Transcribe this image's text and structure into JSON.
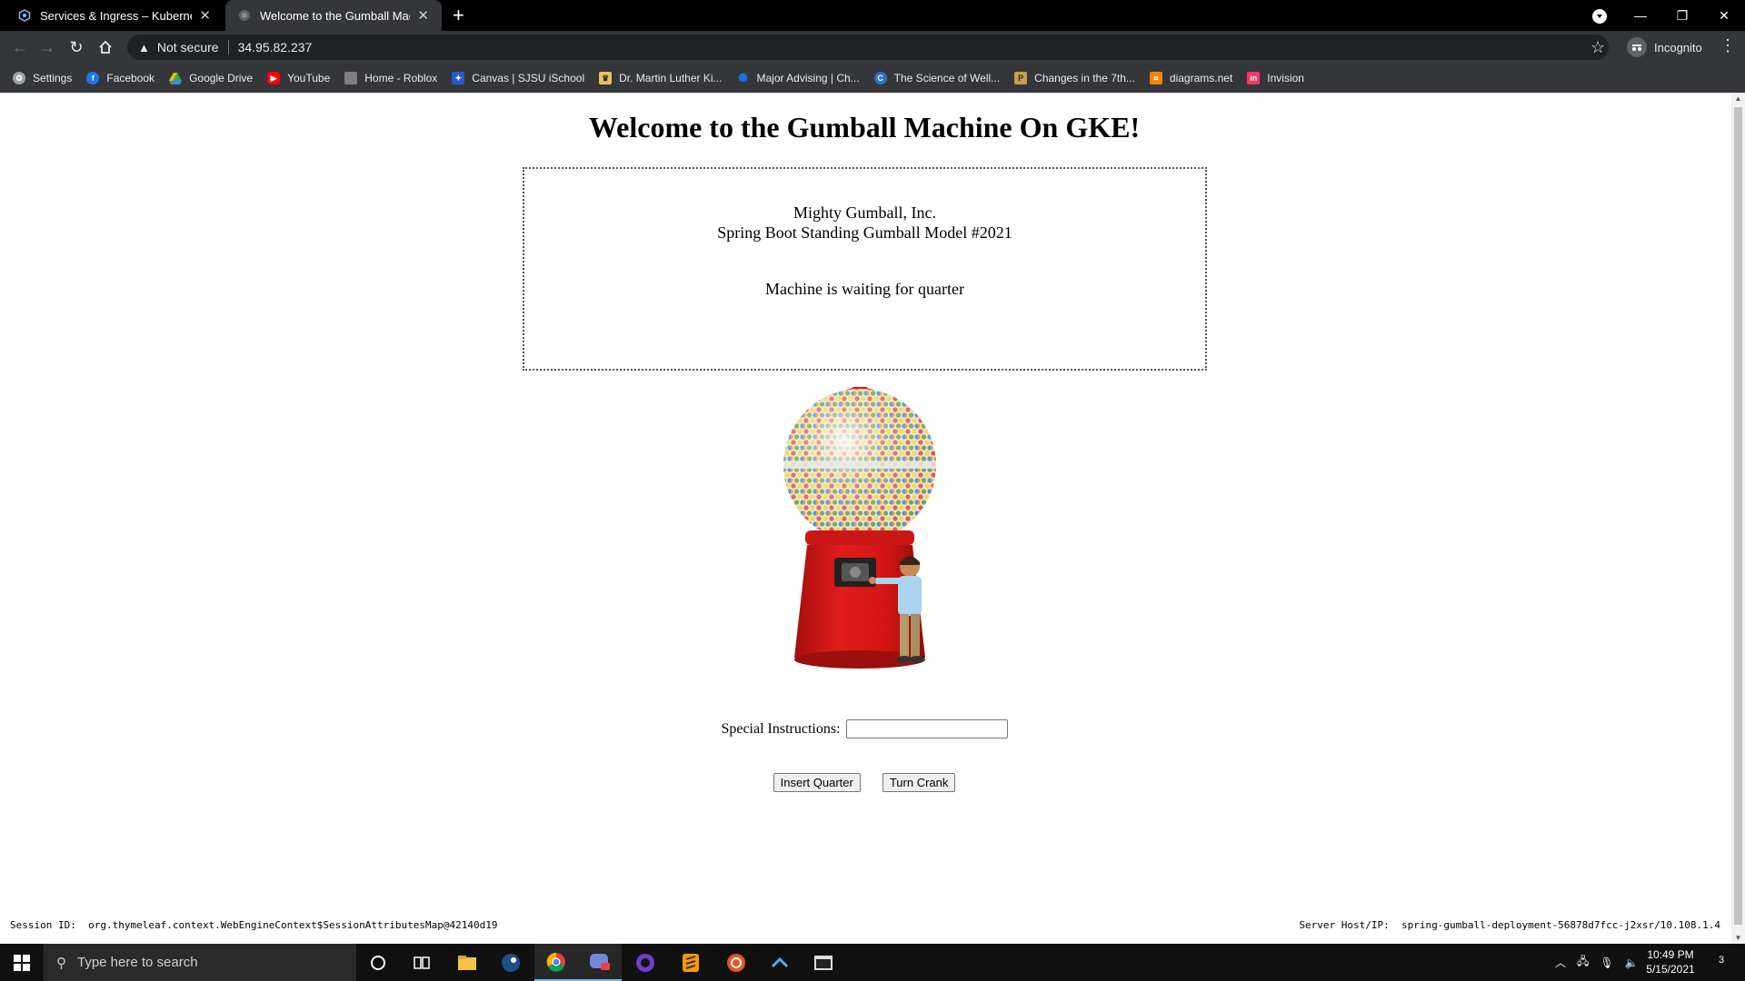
{
  "browser": {
    "tabs": [
      {
        "title": "Services & Ingress – Kubernetes"
      },
      {
        "title": "Welcome to the Gumball Machine"
      }
    ],
    "new_tab": "+",
    "address": {
      "security": "Not secure",
      "url": "34.95.82.237"
    },
    "profile": "Incognito",
    "bookmarks": [
      {
        "label": "Settings",
        "icon": "gear-icon",
        "color": "#9aa0a6"
      },
      {
        "label": "Facebook",
        "icon": "facebook-icon",
        "color": "#1877f2"
      },
      {
        "label": "Google Drive",
        "icon": "google-drive-icon",
        "color": "#34a853"
      },
      {
        "label": "YouTube",
        "icon": "youtube-icon",
        "color": "#ff0000"
      },
      {
        "label": "Home - Roblox",
        "icon": "roblox-icon",
        "color": "#7f7f7f"
      },
      {
        "label": "Canvas | SJSU iSchool",
        "icon": "canvas-icon",
        "color": "#2b58c8"
      },
      {
        "label": "Dr. Martin Luther Ki...",
        "icon": "library-icon",
        "color": "#e5c45a"
      },
      {
        "label": "Major Advising | Ch...",
        "icon": "gear-blue-icon",
        "color": "#1a73e8"
      },
      {
        "label": "The Science of Well...",
        "icon": "coursera-icon",
        "color": "#2a73cc"
      },
      {
        "label": "Changes in the 7th...",
        "icon": "purdue-icon",
        "color": "#c5a14d"
      },
      {
        "label": "diagrams.net",
        "icon": "diagrams-icon",
        "color": "#f08705"
      },
      {
        "label": "Invision",
        "icon": "invision-icon",
        "color": "#ff3366"
      }
    ]
  },
  "page": {
    "heading": "Welcome to the Gumball Machine On GKE!",
    "company": "Mighty Gumball, Inc.",
    "model": "Spring Boot Standing Gumball Model #2021",
    "state": "Machine is waiting for quarter",
    "instructions_label": "Special Instructions:",
    "instructions_value": "",
    "insert_quarter": "Insert Quarter",
    "turn_crank": "Turn Crank",
    "session_label": "Session ID:",
    "session_value": "org.thymeleaf.context.WebEngineContext$SessionAttributesMap@42140d19",
    "server_label": "Server Host/IP:",
    "server_value": "spring-gumball-deployment-56878d7fcc-j2xsr/10.108.1.4"
  },
  "taskbar": {
    "search_placeholder": "Type here to search",
    "time": "10:49 PM",
    "date": "5/15/2021",
    "notifications": "3"
  }
}
